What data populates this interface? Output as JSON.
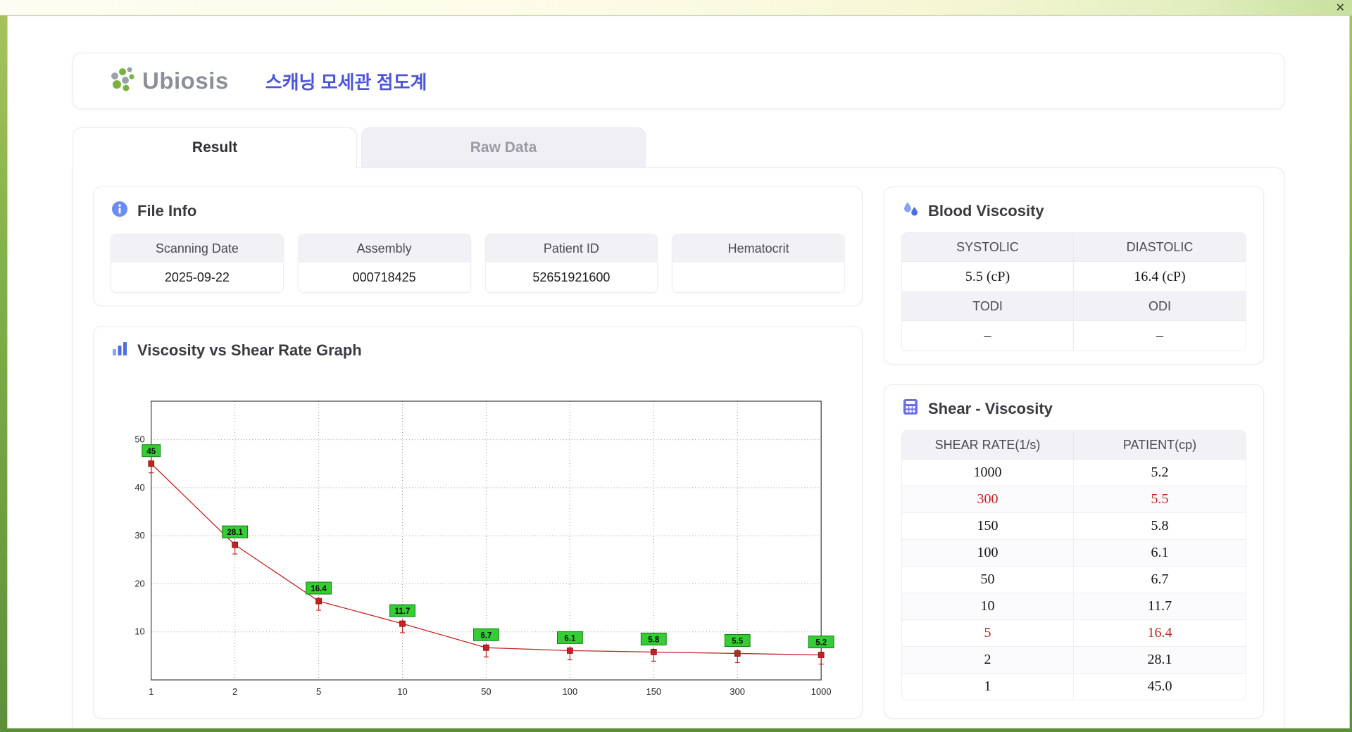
{
  "window": {
    "close_label": "✕"
  },
  "header": {
    "brand": "Ubiosis",
    "app_title": "스캐닝 모세관 점도계"
  },
  "tabs": [
    {
      "label": "Result",
      "active": true
    },
    {
      "label": "Raw Data",
      "active": false
    }
  ],
  "file_info": {
    "title": "File Info",
    "fields": [
      {
        "label": "Scanning Date",
        "value": "2025-09-22"
      },
      {
        "label": "Assembly",
        "value": "000718425"
      },
      {
        "label": "Patient ID",
        "value": "52651921600"
      },
      {
        "label": "Hematocrit",
        "value": ""
      }
    ]
  },
  "blood_viscosity": {
    "title": "Blood Viscosity",
    "row1": {
      "h1": "SYSTOLIC",
      "h2": "DIASTOLIC",
      "v1": "5.5 (cP)",
      "v2": "16.4 (cP)"
    },
    "row2": {
      "h1": "TODI",
      "h2": "ODI",
      "v1": "–",
      "v2": "–"
    }
  },
  "graph": {
    "title": "Viscosity vs Shear Rate Graph"
  },
  "chart_data": {
    "type": "line",
    "title": "Viscosity vs Shear Rate Graph",
    "x_categories": [
      "1",
      "2",
      "5",
      "10",
      "50",
      "100",
      "150",
      "300",
      "1000"
    ],
    "values": [
      45,
      28.1,
      16.4,
      11.7,
      6.7,
      6.1,
      5.8,
      5.5,
      5.2
    ],
    "point_labels": [
      "45",
      "28.1",
      "16.4",
      "11.7",
      "6.7",
      "6.1",
      "5.8",
      "5.5",
      "5.2"
    ],
    "y_ticks": [
      10,
      20,
      30,
      40,
      50
    ],
    "ylim": [
      0,
      58
    ],
    "grid": "dotted",
    "legend": "none",
    "line_color": "#c32222",
    "label_box_color": "#35cc35",
    "label_box_border": "#0f7d0f"
  },
  "shear_table": {
    "title": "Shear - Viscosity",
    "columns": [
      "SHEAR RATE(1/s)",
      "PATIENT(cp)"
    ],
    "rows": [
      {
        "rate": "1000",
        "value": "5.2",
        "highlight": false
      },
      {
        "rate": "300",
        "value": "5.5",
        "highlight": true
      },
      {
        "rate": "150",
        "value": "5.8",
        "highlight": false
      },
      {
        "rate": "100",
        "value": "6.1",
        "highlight": false
      },
      {
        "rate": "50",
        "value": "6.7",
        "highlight": false
      },
      {
        "rate": "10",
        "value": "11.7",
        "highlight": false
      },
      {
        "rate": "5",
        "value": "16.4",
        "highlight": true
      },
      {
        "rate": "2",
        "value": "28.1",
        "highlight": false
      },
      {
        "rate": "1",
        "value": "45.0",
        "highlight": false
      }
    ]
  }
}
